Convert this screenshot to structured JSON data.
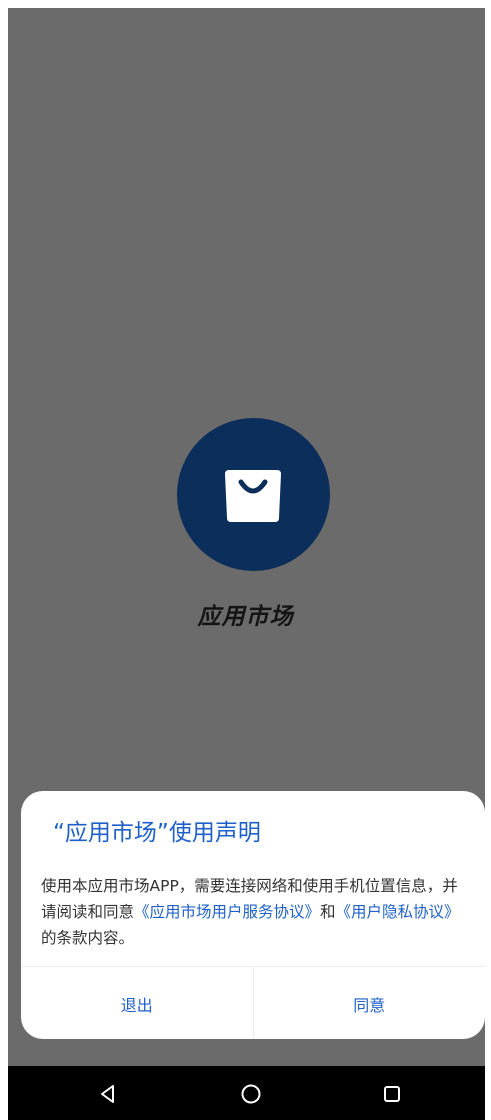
{
  "app": {
    "name": "应用市场",
    "icon": "shopping-bag-icon",
    "icon_bg": "#0c2e5a"
  },
  "dialog": {
    "title": "“应用市场”使用声明",
    "body_prefix": "使用本应用市场APP，需要连接网络和使用手机位置信息，并请阅读和同意",
    "service_agreement_link": "《应用市场用户服务协议》",
    "conjunction": "和",
    "privacy_agreement_link": "《用户隐私协议》",
    "body_suffix": "的条款内容。",
    "exit_label": "退出",
    "agree_label": "同意",
    "accent_color": "#1f61c9"
  },
  "navbar": {
    "back_icon": "triangle-back-icon",
    "home_icon": "circle-home-icon",
    "recents_icon": "square-recents-icon"
  }
}
